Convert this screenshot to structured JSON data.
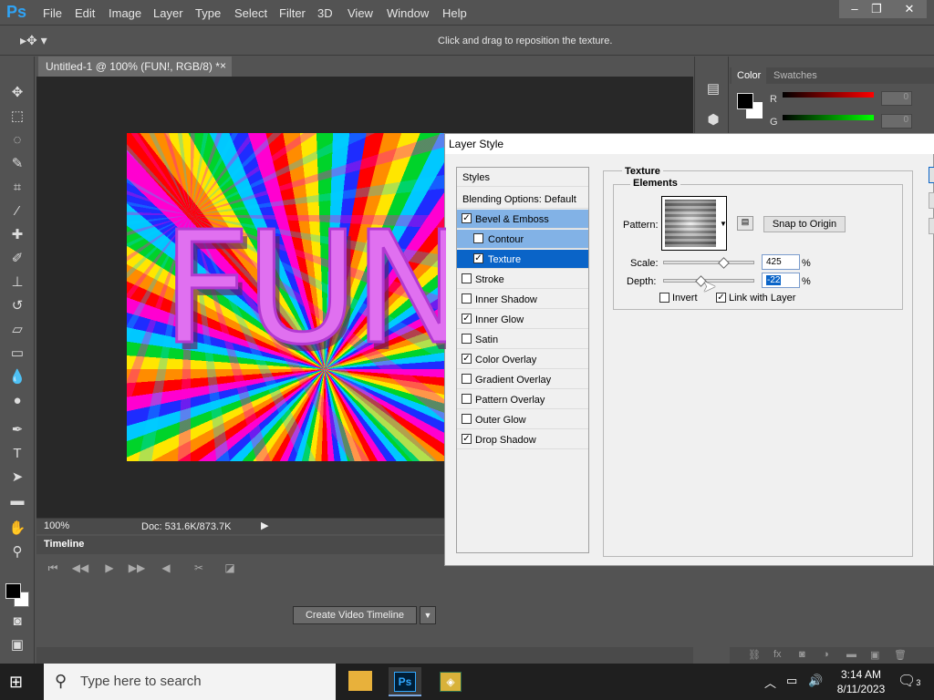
{
  "app": {
    "logo": "Ps"
  },
  "menu": [
    "File",
    "Edit",
    "Image",
    "Layer",
    "Type",
    "Select",
    "Filter",
    "3D",
    "View",
    "Window",
    "Help"
  ],
  "window_controls": {
    "minimize": "–",
    "restore": "❐",
    "close": "✕"
  },
  "options_bar": {
    "hint": "Click and drag to reposition the texture."
  },
  "document": {
    "tab_title": "Untitled-1 @ 100% (FUN!, RGB/8) *",
    "tab_close": "×",
    "canvas_text": "FUN",
    "zoom": "100%",
    "doc_size": "Doc: 531.6K/873.7K"
  },
  "timeline": {
    "title": "Timeline",
    "create_button": "Create Video Timeline",
    "menu_arrow": "▼"
  },
  "color_panel": {
    "tabs": [
      "Color",
      "Swatches"
    ],
    "r_label": "R",
    "g_label": "G",
    "r_value": "0",
    "g_value": "0"
  },
  "dialog": {
    "title": "Layer Style",
    "styles_header": "Styles",
    "blending": "Blending Options: Default",
    "items": [
      {
        "label": "Bevel & Emboss",
        "checked": true
      },
      {
        "label": "Contour",
        "checked": false
      },
      {
        "label": "Texture",
        "checked": true
      },
      {
        "label": "Stroke",
        "checked": false
      },
      {
        "label": "Inner Shadow",
        "checked": false
      },
      {
        "label": "Inner Glow",
        "checked": true
      },
      {
        "label": "Satin",
        "checked": false
      },
      {
        "label": "Color Overlay",
        "checked": true
      },
      {
        "label": "Gradient Overlay",
        "checked": false
      },
      {
        "label": "Pattern Overlay",
        "checked": false
      },
      {
        "label": "Outer Glow",
        "checked": false
      },
      {
        "label": "Drop Shadow",
        "checked": true
      }
    ],
    "texture_group": "Texture",
    "elements_group": "Elements",
    "pattern_label": "Pattern:",
    "snap_button": "Snap to Origin",
    "scale_label": "Scale:",
    "scale_value": "425",
    "depth_label": "Depth:",
    "depth_value": "-22",
    "percent": "%",
    "invert_label": "Invert",
    "invert_checked": false,
    "link_label": "Link with Layer",
    "link_checked": true
  },
  "taskbar": {
    "search_placeholder": "Type here to search",
    "time": "3:14 AM",
    "date": "8/11/2023",
    "notification_count": "3"
  }
}
